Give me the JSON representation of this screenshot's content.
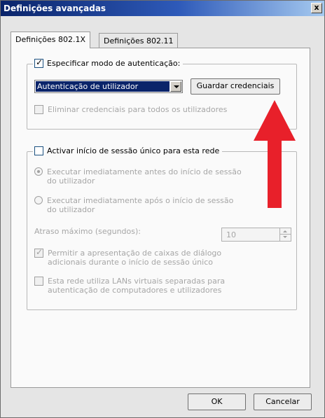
{
  "window": {
    "title": "Definições avançadas",
    "close_glyph": "x"
  },
  "tabs": [
    {
      "label": "Definições 802.1X",
      "active": true
    },
    {
      "label": "Definições 802.11",
      "active": false
    }
  ],
  "auth_group": {
    "checkbox_label": "Especificar modo de autenticação:",
    "checked": true,
    "mode_select_value": "Autenticação de utilizador",
    "save_credentials_button": "Guardar credenciais",
    "delete_credentials_label": "Eliminar credenciais para todos os utilizadores",
    "delete_credentials_checked": false
  },
  "sso_group": {
    "checkbox_label": "Activar início de sessão único para esta rede",
    "checked": false,
    "radio_before_label": "Executar imediatamente antes do início de sessão do utilizador",
    "radio_before_selected": true,
    "radio_after_label": "Executar imediatamente após o início de sessão do utilizador",
    "radio_after_selected": false,
    "max_delay_label": "Atraso máximo (segundos):",
    "max_delay_value": "10",
    "allow_dialogs_label": "Permitir a apresentação de caixas de diálogo adicionais durante o início de sessão único",
    "allow_dialogs_checked": true,
    "vlan_label": "Esta rede utiliza LANs virtuais separadas para autenticação de computadores e utilizadores",
    "vlan_checked": false
  },
  "footer": {
    "ok_button": "OK",
    "cancel_button": "Cancelar"
  },
  "colors": {
    "title_bar": "#0a246a",
    "selection": "#0a246a",
    "annotation_arrow": "#e8202a"
  },
  "icons": {
    "close": "close-icon",
    "dropdown": "chevron-down-icon",
    "spin_up": "spin-up-icon",
    "spin_down": "spin-down-icon"
  }
}
